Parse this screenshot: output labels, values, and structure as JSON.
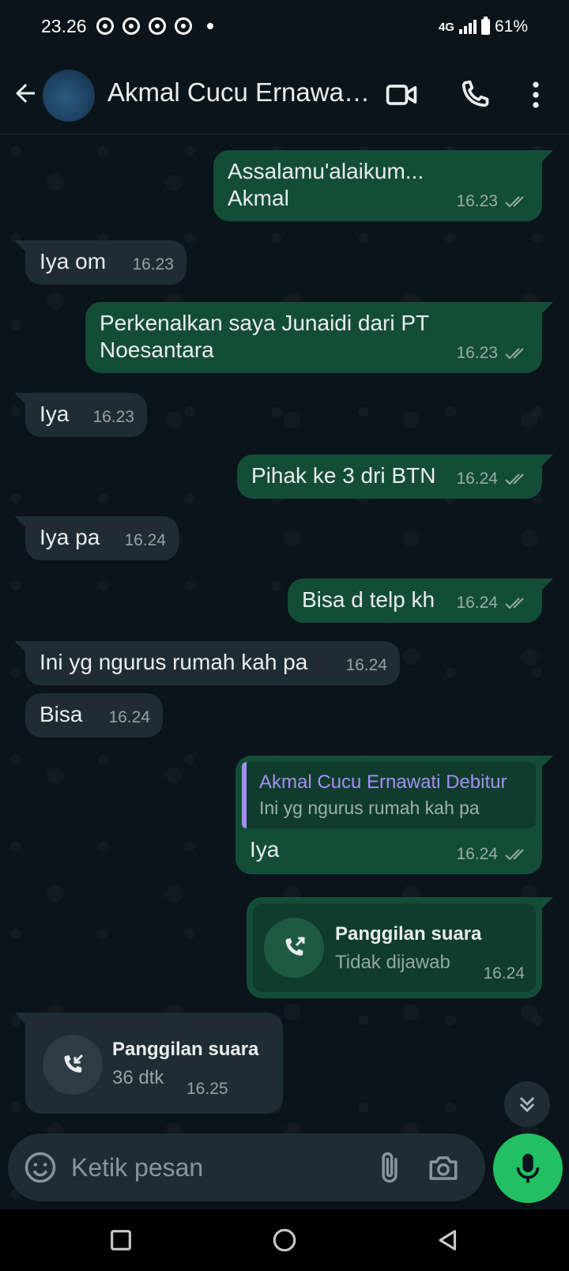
{
  "status_bar": {
    "time": "23.26",
    "network": "4G",
    "battery": "61%"
  },
  "header": {
    "contact_name": "Akmal Cucu Ernawa…"
  },
  "messages": [
    {
      "text": "Assalamu'alaikum...\nAkmal",
      "time": "16.23"
    },
    {
      "text": "Iya om",
      "time": "16.23"
    },
    {
      "text": "Perkenalkan saya Junaidi dari PT Noesantara",
      "time": "16.23"
    },
    {
      "text": "Iya",
      "time": "16.23"
    },
    {
      "text": "Pihak ke 3 dri BTN",
      "time": "16.24"
    },
    {
      "text": "Iya pa",
      "time": "16.24"
    },
    {
      "text": "Bisa d telp kh",
      "time": "16.24"
    },
    {
      "text": "Ini yg ngurus rumah kah pa",
      "time": "16.24"
    },
    {
      "text": "Bisa",
      "time": "16.24"
    },
    {
      "text": "Iya",
      "time": "16.24",
      "quote_name": "Akmal Cucu Ernawati Debitur",
      "quote_text": "Ini yg ngurus rumah kah pa"
    }
  ],
  "calls": [
    {
      "title": "Panggilan suara",
      "subtitle": "Tidak dijawab",
      "time": "16.24",
      "icon": "outgoing-call-icon"
    },
    {
      "title": "Panggilan suara",
      "subtitle": "36 dtk",
      "time": "16.25",
      "icon": "incoming-call-icon"
    }
  ],
  "composer": {
    "placeholder": "Ketik pesan"
  },
  "colors": {
    "background": "#0b141a",
    "outgoing_bubble": "#144d37",
    "incoming_bubble": "#1f2c33",
    "quote_accent": "#a58df5",
    "mic_button": "#21c063"
  }
}
